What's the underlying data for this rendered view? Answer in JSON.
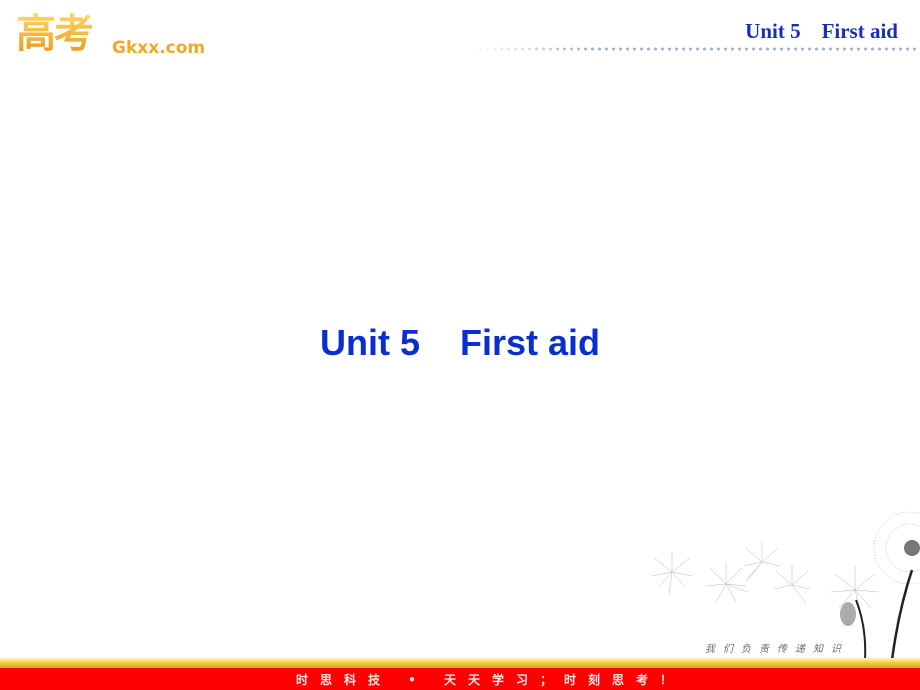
{
  "logo": {
    "chinese": "高考",
    "site": "Gkxx.com"
  },
  "header": {
    "title": "Unit 5    First aid"
  },
  "slide": {
    "title": "Unit 5    First aid"
  },
  "decoration": {
    "image": "dandelion-illustration",
    "slogan": "我们负责传递知识"
  },
  "footer": {
    "slogan": "时思科技 • 天天学习；时刻思考！",
    "colors": {
      "bar": "#ff0000",
      "stripe": "#f0d040"
    }
  }
}
